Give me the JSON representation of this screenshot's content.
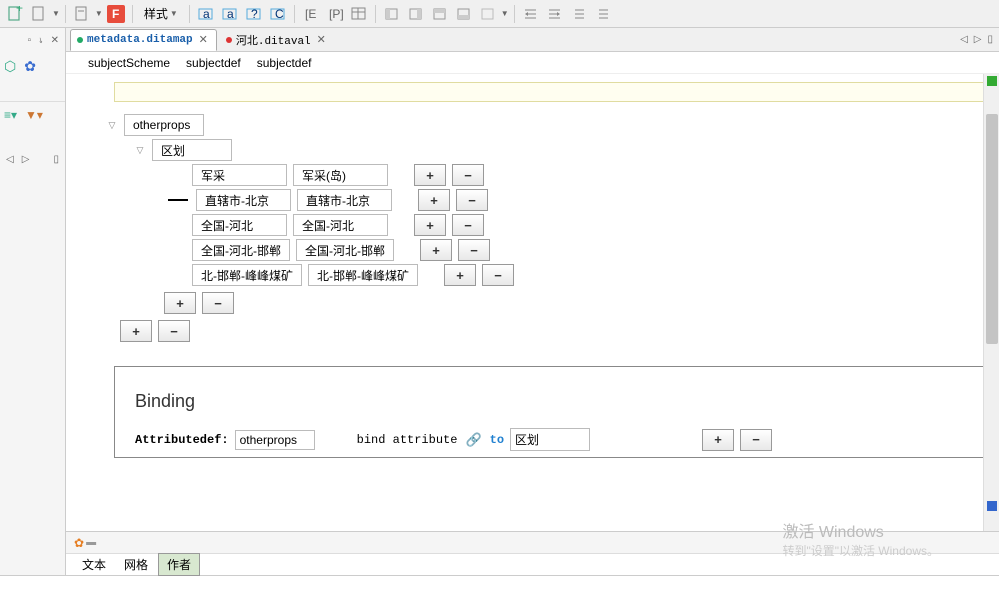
{
  "toolbar": {
    "style_label": "样式",
    "f_badge": "F"
  },
  "tabs": [
    {
      "text": "metadata.ditamap",
      "dot": "#2a6",
      "active": true
    },
    {
      "text": "河北.ditaval",
      "dot": "#d33",
      "active": false
    }
  ],
  "breadcrumb": [
    "subjectScheme",
    "subjectdef",
    "subjectdef"
  ],
  "tree": {
    "root": "otherprops",
    "child1": "区划",
    "rows": [
      {
        "a": "军采",
        "b": "军采(岛)"
      },
      {
        "a": "直辖市-北京",
        "b": "直辖市-北京"
      },
      {
        "a": "全国-河北",
        "b": "全国-河北"
      },
      {
        "a": "全国-河北-邯郸",
        "b": "全国-河北-邯郸"
      },
      {
        "a": "北-邯郸-峰峰煤矿",
        "b": "北-邯郸-峰峰煤矿"
      }
    ],
    "plus": "+",
    "minus": "−"
  },
  "binding": {
    "title": "Binding",
    "attr_label": "Attributedef:",
    "attr_value": "otherprops",
    "bind_attribute": "bind attribute",
    "to": "to",
    "target": "区划"
  },
  "view_tabs": {
    "text": "文本",
    "grid": "网格",
    "author": "作者"
  },
  "watermark": {
    "line1": "激活 Windows",
    "line2": "转到\"设置\"以激活 Windows。"
  }
}
